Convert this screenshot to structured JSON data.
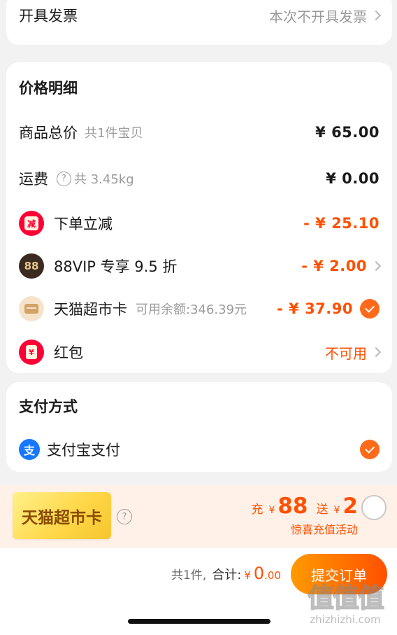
{
  "invoice": {
    "label": "开具发票",
    "value": "本次不开具发票"
  },
  "price_detail": {
    "title": "价格明细",
    "subtotal": {
      "label": "商品总价",
      "note": "共1件宝贝",
      "value": "¥ 65.00"
    },
    "shipping": {
      "label": "运费",
      "note": "共 3.45kg",
      "value": "¥ 0.00"
    },
    "discount": {
      "label": "下单立减",
      "icon_text": "减",
      "value": "- ¥ 25.10"
    },
    "vip": {
      "label": "88VIP 专享 9.5 折",
      "icon_text": "88",
      "value": "- ¥ 2.00"
    },
    "market_card": {
      "label": "天猫超市卡",
      "note": "可用余额:346.39元",
      "value": "- ¥ 37.90"
    },
    "red_packet": {
      "label": "红包",
      "icon_text": "¥",
      "value": "不可用"
    }
  },
  "payment": {
    "title": "支付方式",
    "method": {
      "label": "支付宝支付",
      "icon_text": "支"
    }
  },
  "promo": {
    "card_label": "天猫超市卡",
    "recharge_prefix": "充",
    "recharge_currency": "¥",
    "recharge_amount": "88",
    "gift_prefix": "送",
    "gift_currency": "¥",
    "gift_amount": "2",
    "subtitle": "惊喜充值活动"
  },
  "footer": {
    "count": "共1件,",
    "total_label": "合计:",
    "currency": "¥",
    "total_int": "0",
    "total_dec": ".00",
    "submit_label": "提交订单"
  },
  "watermark": {
    "brand": "值值值",
    "domain": "zhizhizhi.com"
  },
  "colors": {
    "accent": "#ff5000",
    "alipay": "#1677ff",
    "tmall_red": "#ff0036"
  }
}
